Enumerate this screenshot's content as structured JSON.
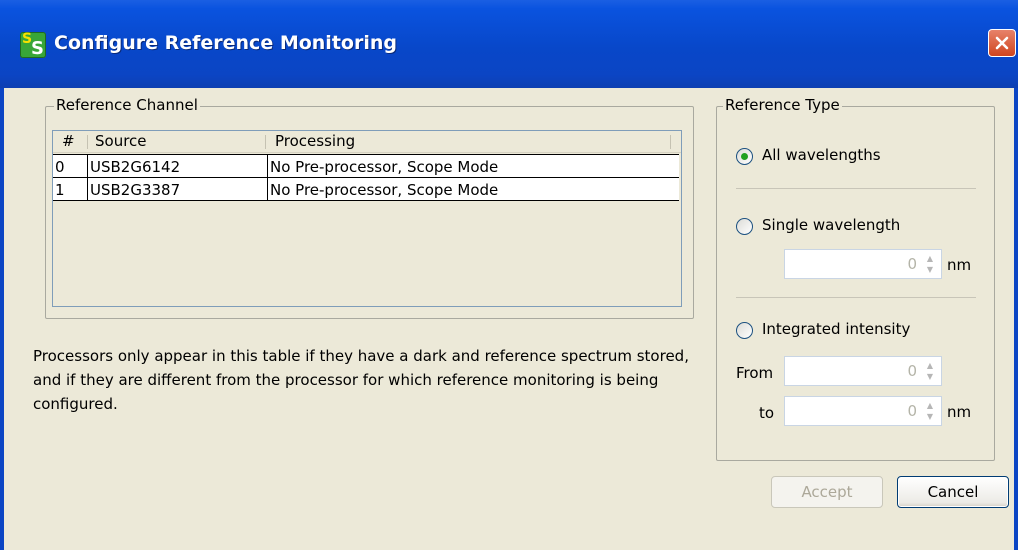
{
  "window": {
    "title": "Configure Reference Monitoring",
    "icon_text_top": "S",
    "icon_text_bottom": "S"
  },
  "reference_channel": {
    "label": "Reference Channel",
    "columns": [
      "#",
      "Source",
      "Processing"
    ],
    "rows": [
      {
        "num": "0",
        "source": "USB2G6142",
        "processing": "No Pre-processor, Scope Mode"
      },
      {
        "num": "1",
        "source": "USB2G3387",
        "processing": "No Pre-processor, Scope Mode"
      }
    ]
  },
  "note": "Processors only appear in this table if they have a dark and reference spectrum stored, and if they are different from the processor for which reference monitoring is being configured.",
  "reference_type": {
    "label": "Reference Type",
    "selected": "all",
    "options": {
      "all": "All wavelengths",
      "single": "Single wavelength",
      "integrated": "Integrated intensity"
    },
    "single_value": "0",
    "single_unit": "nm",
    "from_label": "From",
    "from_value": "0",
    "to_label": "to",
    "to_value": "0",
    "to_unit": "nm"
  },
  "buttons": {
    "accept": "Accept",
    "cancel": "Cancel"
  },
  "colors": {
    "titlebar": "#0847c9",
    "close": "#d0451e",
    "radio_selected": "#21a121"
  }
}
